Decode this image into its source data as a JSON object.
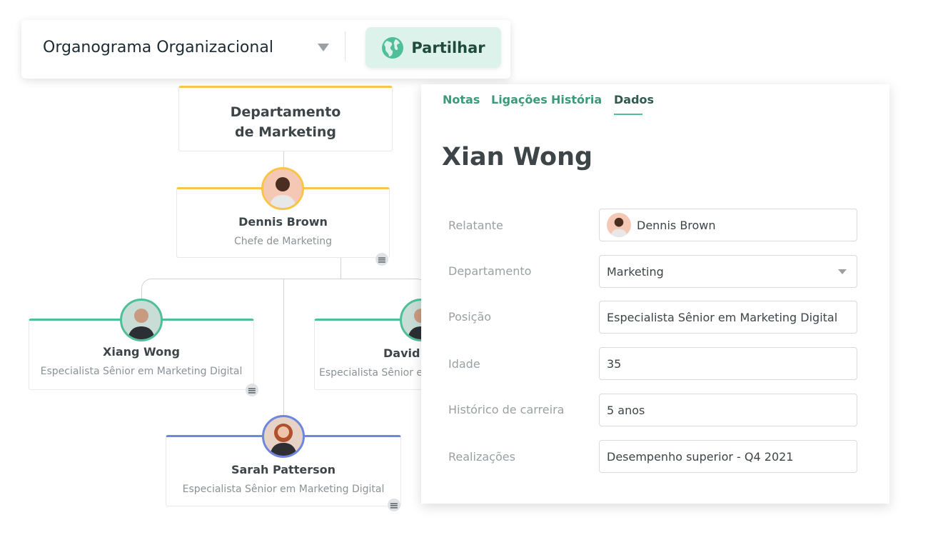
{
  "header": {
    "title": "Organograma Organizacional",
    "share_label": "Partilhar",
    "share_icon": "globe-icon"
  },
  "colors": {
    "accent": "#4fbf9a",
    "yellow": "#f9c549",
    "blue": "#6f86e0"
  },
  "org": {
    "department": {
      "line1": "Departamento",
      "line2": "de Marketing"
    },
    "head": {
      "name": "Dennis Brown",
      "role": "Chefe de Marketing"
    },
    "reports": [
      {
        "name": "Xiang Wong",
        "role": "Especialista Sênior em Marketing Digital"
      },
      {
        "name": "David",
        "role": "Especialista Sênior em Marketing Digital"
      },
      {
        "name": "Sarah Patterson",
        "role": "Especialista Sênior em Marketing Digital"
      }
    ]
  },
  "panel": {
    "tabs": [
      {
        "label": "Notas"
      },
      {
        "label": "Ligações"
      },
      {
        "label": "História"
      },
      {
        "label": "Dados",
        "active": true
      }
    ],
    "name": "Xian Wong",
    "fields": [
      {
        "label": "Relatante",
        "value": "Dennis Brown"
      },
      {
        "label": "Departamento",
        "value": "Marketing"
      },
      {
        "label": "Posição",
        "value": "Especialista Sênior em Marketing Digital"
      },
      {
        "label": "Idade",
        "value": "35"
      },
      {
        "label": "Histórico de carreira",
        "value": "5 anos"
      },
      {
        "label": "Realizações",
        "value": "Desempenho superior - Q4 2021"
      }
    ]
  }
}
